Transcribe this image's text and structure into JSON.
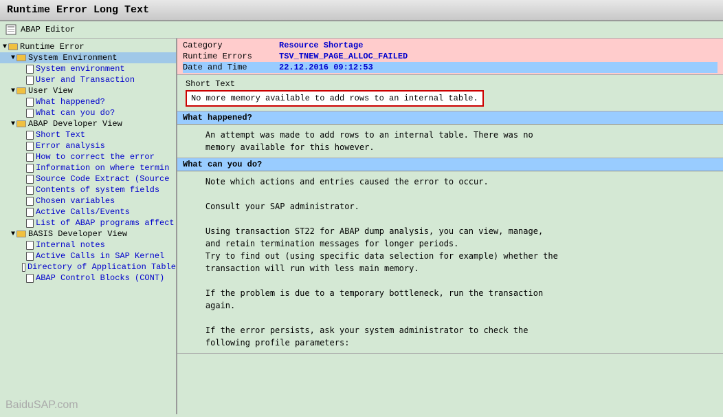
{
  "title": "Runtime Error Long Text",
  "toolbar": {
    "icon": "📋",
    "label": "ABAP Editor"
  },
  "info": {
    "rows": [
      {
        "key": "Category",
        "value": "Resource Shortage",
        "style": "normal"
      },
      {
        "key": "Runtime Errors",
        "value": "TSV_TNEW_PAGE_ALLOC_FAILED",
        "style": "normal"
      },
      {
        "key": "Date and Time",
        "value": "22.12.2016 09:12:53",
        "style": "blue"
      }
    ]
  },
  "short_text": {
    "label": "Short Text",
    "value": "No more memory available to add rows to an internal table."
  },
  "what_happened": {
    "header": "What happened?",
    "text": "    An attempt was made to add rows to an internal table. There was no\n    memory available for this however."
  },
  "what_can_you_do": {
    "header": "What can you do?",
    "text": "    Note which actions and entries caused the error to occur.\n\n    Consult your SAP administrator.\n\n    Using transaction ST22 for ABAP dump analysis, you can view, manage,\n    and retain termination messages for longer periods.\n    Try to find out (using specific data selection for example) whether the\n    transaction will run with less main memory.\n\n    If the problem is due to a temporary bottleneck, run the transaction\n    again.\n\n    If the error persists, ask your system administrator to check the\n    following profile parameters:"
  },
  "tree": {
    "items": [
      {
        "id": "runtime-error",
        "label": "Runtime Error",
        "type": "folder-open",
        "indent": 0,
        "arrow": "▼"
      },
      {
        "id": "system-environment-group",
        "label": "System Environment",
        "type": "folder-open",
        "indent": 1,
        "arrow": "▼",
        "selected": true
      },
      {
        "id": "system-environment",
        "label": "System environment",
        "type": "doc",
        "indent": 2,
        "arrow": ""
      },
      {
        "id": "user-and-transaction",
        "label": "User and Transaction",
        "type": "doc",
        "indent": 2,
        "arrow": ""
      },
      {
        "id": "user-view-group",
        "label": "User View",
        "type": "folder-open",
        "indent": 1,
        "arrow": "▼"
      },
      {
        "id": "what-happened",
        "label": "What happened?",
        "type": "doc",
        "indent": 2,
        "arrow": ""
      },
      {
        "id": "what-can-you-do",
        "label": "What can you do?",
        "type": "doc",
        "indent": 2,
        "arrow": ""
      },
      {
        "id": "abap-developer-view-group",
        "label": "ABAP Developer View",
        "type": "folder-open",
        "indent": 1,
        "arrow": "▼"
      },
      {
        "id": "short-text",
        "label": "Short Text",
        "type": "doc",
        "indent": 2,
        "arrow": ""
      },
      {
        "id": "error-analysis",
        "label": "Error analysis",
        "type": "doc",
        "indent": 2,
        "arrow": ""
      },
      {
        "id": "how-to-correct",
        "label": "How to correct the error",
        "type": "doc",
        "indent": 2,
        "arrow": ""
      },
      {
        "id": "information-on-where",
        "label": "Information on where termin",
        "type": "doc",
        "indent": 2,
        "arrow": ""
      },
      {
        "id": "source-code-extract",
        "label": "Source Code Extract (Source",
        "type": "doc",
        "indent": 2,
        "arrow": ""
      },
      {
        "id": "contents-system-fields",
        "label": "Contents of system fields",
        "type": "doc",
        "indent": 2,
        "arrow": ""
      },
      {
        "id": "chosen-variables",
        "label": "Chosen variables",
        "type": "doc",
        "indent": 2,
        "arrow": ""
      },
      {
        "id": "active-calls-events",
        "label": "Active Calls/Events",
        "type": "doc",
        "indent": 2,
        "arrow": ""
      },
      {
        "id": "list-abap-programs",
        "label": "List of ABAP programs affect",
        "type": "doc",
        "indent": 2,
        "arrow": ""
      },
      {
        "id": "basis-developer-view-group",
        "label": "BASIS Developer View",
        "type": "folder-open",
        "indent": 1,
        "arrow": "▼"
      },
      {
        "id": "internal-notes",
        "label": "Internal notes",
        "type": "doc",
        "indent": 2,
        "arrow": ""
      },
      {
        "id": "active-calls-sap-kernel",
        "label": "Active Calls in SAP Kernel",
        "type": "doc",
        "indent": 2,
        "arrow": ""
      },
      {
        "id": "directory-application-table",
        "label": "Directory of Application Table",
        "type": "doc",
        "indent": 2,
        "arrow": ""
      },
      {
        "id": "abap-control-blocks",
        "label": "ABAP Control Blocks (CONT)",
        "type": "doc",
        "indent": 2,
        "arrow": ""
      }
    ]
  },
  "watermark": "BaiduSAP.com"
}
